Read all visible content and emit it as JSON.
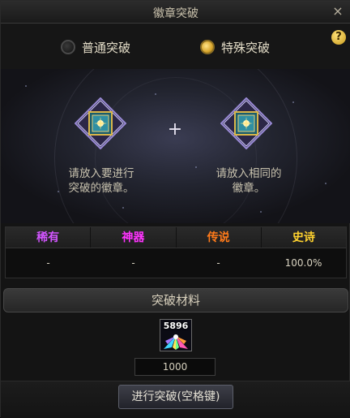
{
  "window": {
    "title": "徽章突破",
    "close_icon": "×"
  },
  "mode": {
    "normal_label": "普通突破",
    "special_label": "特殊突破",
    "selected": "special",
    "help_icon": "?"
  },
  "stage": {
    "plus": "+",
    "left_text": "请放入要进行\n突破的徽章。",
    "right_text": "请放入相同的\n徽章。"
  },
  "rarity": {
    "headers": [
      {
        "label": "稀有",
        "color": "#d255ff"
      },
      {
        "label": "神器",
        "color": "#ff33ff"
      },
      {
        "label": "传说",
        "color": "#ff7a1a"
      },
      {
        "label": "史诗",
        "color": "#ffd22e"
      }
    ],
    "values": [
      "-",
      "-",
      "-",
      "100.0%"
    ]
  },
  "materials": {
    "title": "突破材料",
    "item_count": "5896",
    "quantity": "1000"
  },
  "action": {
    "label": "进行突破(空格键)"
  }
}
